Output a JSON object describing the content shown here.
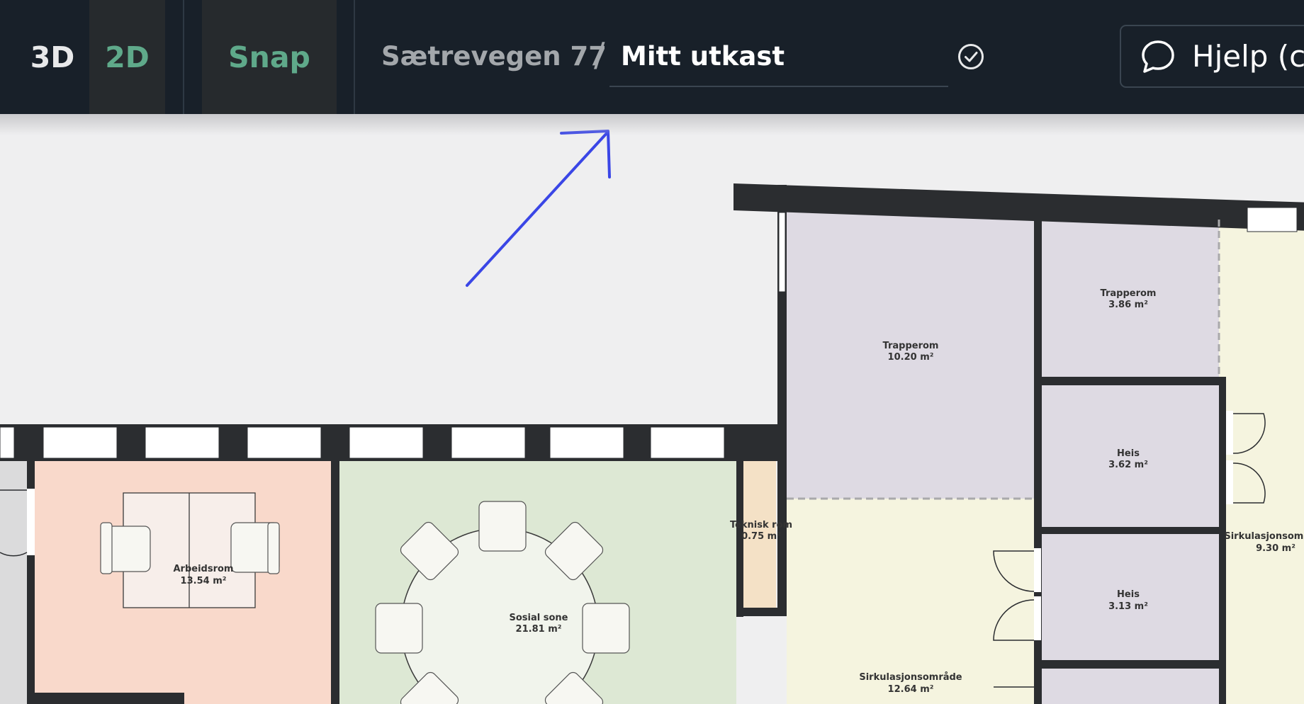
{
  "toolbar": {
    "view_3d": "3D",
    "view_2d": "2D",
    "snap": "Snap"
  },
  "breadcrumb": {
    "address": "Sætrevegen 77",
    "separator": "/",
    "draft_name": "Mitt utkast"
  },
  "help": {
    "label": "Hjelp (c"
  },
  "icons": {
    "saved": "check-circle-icon",
    "help": "chat-bubble-icon"
  },
  "colors": {
    "topbar": "#182029",
    "snap_green": "#5fa98a",
    "annotation_arrow": "#3a46e6"
  },
  "rooms": [
    {
      "name": "Trapperom",
      "area": "10.20 m²"
    },
    {
      "name": "Trapperom",
      "area": "3.86 m²"
    },
    {
      "name": "Heis",
      "area": "3.62 m²"
    },
    {
      "name": "Heis",
      "area": "3.13 m²"
    },
    {
      "name": "Teknisk rom",
      "area": "0.75 m²"
    },
    {
      "name": "Sirkulasjonsområde",
      "area": "9.30 m²"
    },
    {
      "name": "Arbeidsrom",
      "area": "13.54 m²"
    },
    {
      "name": "Sosial sone",
      "area": "21.81 m²"
    },
    {
      "name": "Sirkulasjonsområde",
      "area": "12.64 m²"
    }
  ]
}
